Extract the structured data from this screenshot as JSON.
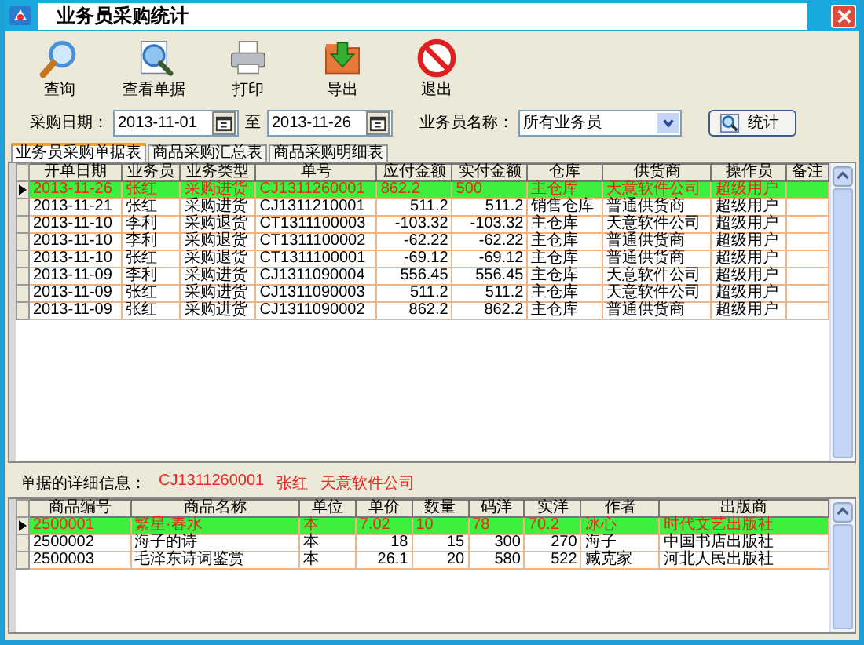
{
  "window": {
    "title": "业务员采购统计"
  },
  "toolbar": [
    {
      "kind": "search",
      "label": "查询"
    },
    {
      "kind": "view",
      "label": "查看单据"
    },
    {
      "kind": "print",
      "label": "打印"
    },
    {
      "kind": "export",
      "label": "导出"
    },
    {
      "kind": "exit",
      "label": "退出"
    }
  ],
  "filter": {
    "date_label": "采购日期：",
    "date_from": "2013-11-01",
    "separator": "至",
    "date_to": "2013-11-26",
    "clerk_label": "业务员名称：",
    "clerk_value": "所有业务员",
    "stat_button": "统计"
  },
  "tabs": [
    {
      "label": "业务员采购单据表",
      "selected": true
    },
    {
      "label": "商品采购汇总表",
      "selected": false
    },
    {
      "label": "商品采购明细表",
      "selected": false
    }
  ],
  "orders": {
    "columns": [
      {
        "label": "开单日期",
        "kind": "text"
      },
      {
        "label": "业务员",
        "kind": "text"
      },
      {
        "label": "业务类型",
        "kind": "text"
      },
      {
        "label": "单号",
        "kind": "text"
      },
      {
        "label": "应付金额",
        "kind": "number"
      },
      {
        "label": "实付金额",
        "kind": "number"
      },
      {
        "label": "仓库",
        "kind": "text"
      },
      {
        "label": "供货商",
        "kind": "text"
      },
      {
        "label": "操作员",
        "kind": "text"
      },
      {
        "label": "备注",
        "kind": "text"
      }
    ],
    "rows": [
      {
        "selected": true,
        "cells": [
          "2013-11-26",
          "张红",
          "采购进货",
          "CJ1311260001",
          "862.2",
          "500",
          "主仓库",
          "天意软件公司",
          "超级用户",
          ""
        ]
      },
      {
        "selected": false,
        "cells": [
          "2013-11-21",
          "张红",
          "采购进货",
          "CJ1311210001",
          "511.2",
          "511.2",
          "销售仓库",
          "普通供货商",
          "超级用户",
          ""
        ]
      },
      {
        "selected": false,
        "cells": [
          "2013-11-10",
          "李利",
          "采购退货",
          "CT1311100003",
          "-103.32",
          "-103.32",
          "主仓库",
          "天意软件公司",
          "超级用户",
          ""
        ]
      },
      {
        "selected": false,
        "cells": [
          "2013-11-10",
          "李利",
          "采购退货",
          "CT1311100002",
          "-62.22",
          "-62.22",
          "主仓库",
          "普通供货商",
          "超级用户",
          ""
        ]
      },
      {
        "selected": false,
        "cells": [
          "2013-11-10",
          "张红",
          "采购退货",
          "CT1311100001",
          "-69.12",
          "-69.12",
          "主仓库",
          "普通供货商",
          "超级用户",
          ""
        ]
      },
      {
        "selected": false,
        "cells": [
          "2013-11-09",
          "李利",
          "采购进货",
          "CJ1311090004",
          "556.45",
          "556.45",
          "主仓库",
          "天意软件公司",
          "超级用户",
          ""
        ]
      },
      {
        "selected": false,
        "cells": [
          "2013-11-09",
          "张红",
          "采购进货",
          "CJ1311090003",
          "511.2",
          "511.2",
          "主仓库",
          "天意软件公司",
          "超级用户",
          ""
        ]
      },
      {
        "selected": false,
        "cells": [
          "2013-11-09",
          "张红",
          "采购进货",
          "CJ1311090002",
          "862.2",
          "862.2",
          "主仓库",
          "普通供货商",
          "超级用户",
          ""
        ]
      }
    ]
  },
  "detail": {
    "label": "单据的详细信息：",
    "order_no": "CJ1311260001",
    "clerk": "张红",
    "supplier": "天意软件公司"
  },
  "items": {
    "columns": [
      {
        "label": "商品编号",
        "kind": "text"
      },
      {
        "label": "商品名称",
        "kind": "text"
      },
      {
        "label": "单位",
        "kind": "text"
      },
      {
        "label": "单价",
        "kind": "number"
      },
      {
        "label": "数量",
        "kind": "number"
      },
      {
        "label": "码洋",
        "kind": "number"
      },
      {
        "label": "实洋",
        "kind": "number"
      },
      {
        "label": "作者",
        "kind": "text"
      },
      {
        "label": "出版商",
        "kind": "text"
      }
    ],
    "rows": [
      {
        "selected": true,
        "cells": [
          "2500001",
          "繁星·春水",
          "本",
          "7.02",
          "10",
          "78",
          "70.2",
          "冰心",
          "时代文艺出版社"
        ]
      },
      {
        "selected": false,
        "cells": [
          "2500002",
          "海子的诗",
          "本",
          "18",
          "15",
          "300",
          "270",
          "海子",
          "中国书店出版社"
        ]
      },
      {
        "selected": false,
        "cells": [
          "2500003",
          "毛泽东诗词鉴赏",
          "本",
          "26.1",
          "20",
          "580",
          "522",
          "臧克家",
          "河北人民出版社"
        ]
      }
    ]
  }
}
